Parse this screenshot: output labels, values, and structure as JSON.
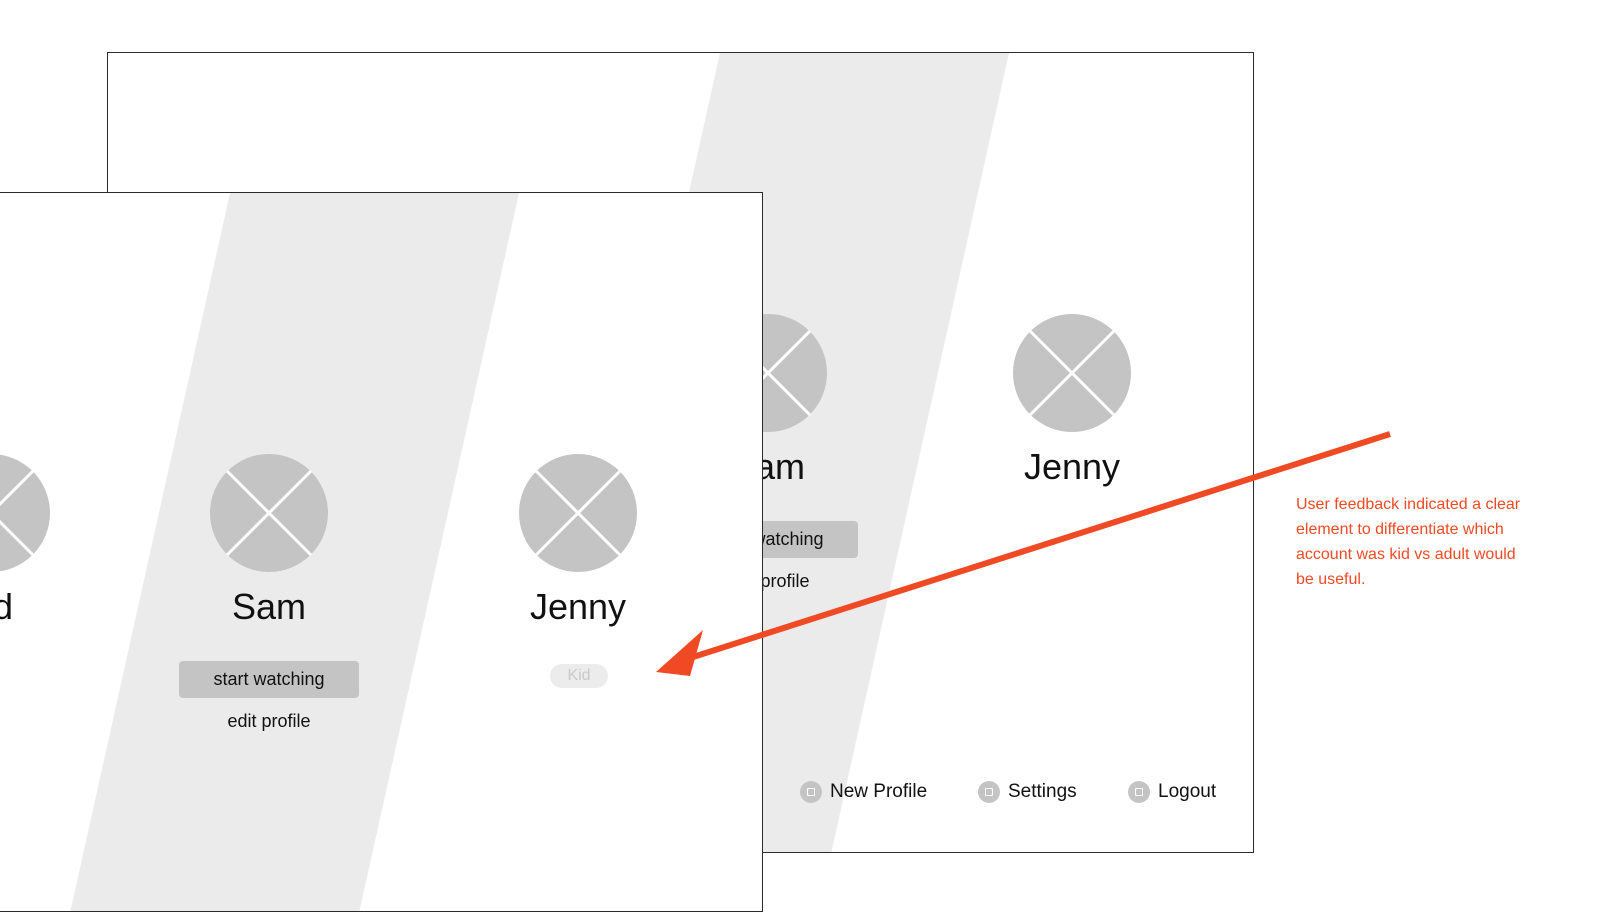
{
  "back_screen": {
    "profiles": [
      {
        "name": "Sam",
        "primary_action": "start watching",
        "secondary_action": "edit profile"
      },
      {
        "name": "Jenny"
      }
    ],
    "bottom_bar": [
      {
        "label": "New Profile",
        "icon": "add-profile-icon"
      },
      {
        "label": "Settings",
        "icon": "settings-icon"
      },
      {
        "label": "Logout",
        "icon": "logout-icon"
      }
    ]
  },
  "front_screen": {
    "profiles": [
      {
        "name": "Ed"
      },
      {
        "name": "Sam",
        "primary_action": "start watching",
        "secondary_action": "edit profile"
      },
      {
        "name": "Jenny",
        "badge": "Kid"
      }
    ]
  },
  "annotation": {
    "text": "User feedback indicated a clear element to differentiate which account was kid vs adult would be useful.",
    "color": "#f04a24"
  },
  "colors": {
    "stripe": "#ebebeb",
    "avatar": "#c4c4c4",
    "button": "#c4c4c4",
    "arrow": "#f04a24"
  }
}
